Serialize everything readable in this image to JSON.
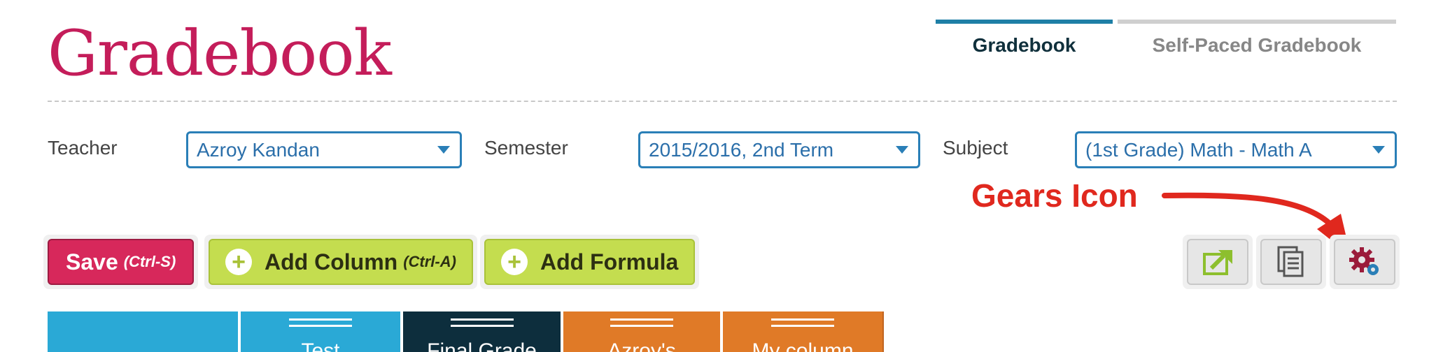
{
  "page": {
    "title": "Gradebook"
  },
  "tabs": [
    {
      "label": "Gradebook",
      "active": true
    },
    {
      "label": "Self-Paced Gradebook",
      "active": false
    }
  ],
  "filters": {
    "teacher": {
      "label": "Teacher",
      "value": "Azroy Kandan"
    },
    "semester": {
      "label": "Semester",
      "value": "2015/2016, 2nd Term"
    },
    "subject": {
      "label": "Subject",
      "value": "(1st Grade) Math - Math A"
    }
  },
  "annotation": {
    "text": "Gears Icon",
    "color": "#e0281e"
  },
  "toolbar": {
    "save_label": "Save",
    "save_hint": "(Ctrl-S)",
    "add_column_label": "Add Column",
    "add_column_hint": "(Ctrl-A)",
    "add_formula_label": "Add Formula",
    "icons": [
      "export-icon",
      "copy-pages-icon",
      "gears-icon"
    ]
  },
  "columns": [
    {
      "label": "",
      "color": "#2aa9d6"
    },
    {
      "label": "Test",
      "color": "#2aa9d6"
    },
    {
      "label": "Final Grade",
      "color": "#0d2e3d"
    },
    {
      "label": "Azroy's",
      "color": "#e07a27"
    },
    {
      "label": "My column",
      "color": "#e07a27"
    }
  ],
  "colors": {
    "brand": "#c41d5a",
    "accent": "#1e7fa6",
    "select_border": "#2a7fb7",
    "save": "#d7285b",
    "green": "#c4dd4f"
  }
}
